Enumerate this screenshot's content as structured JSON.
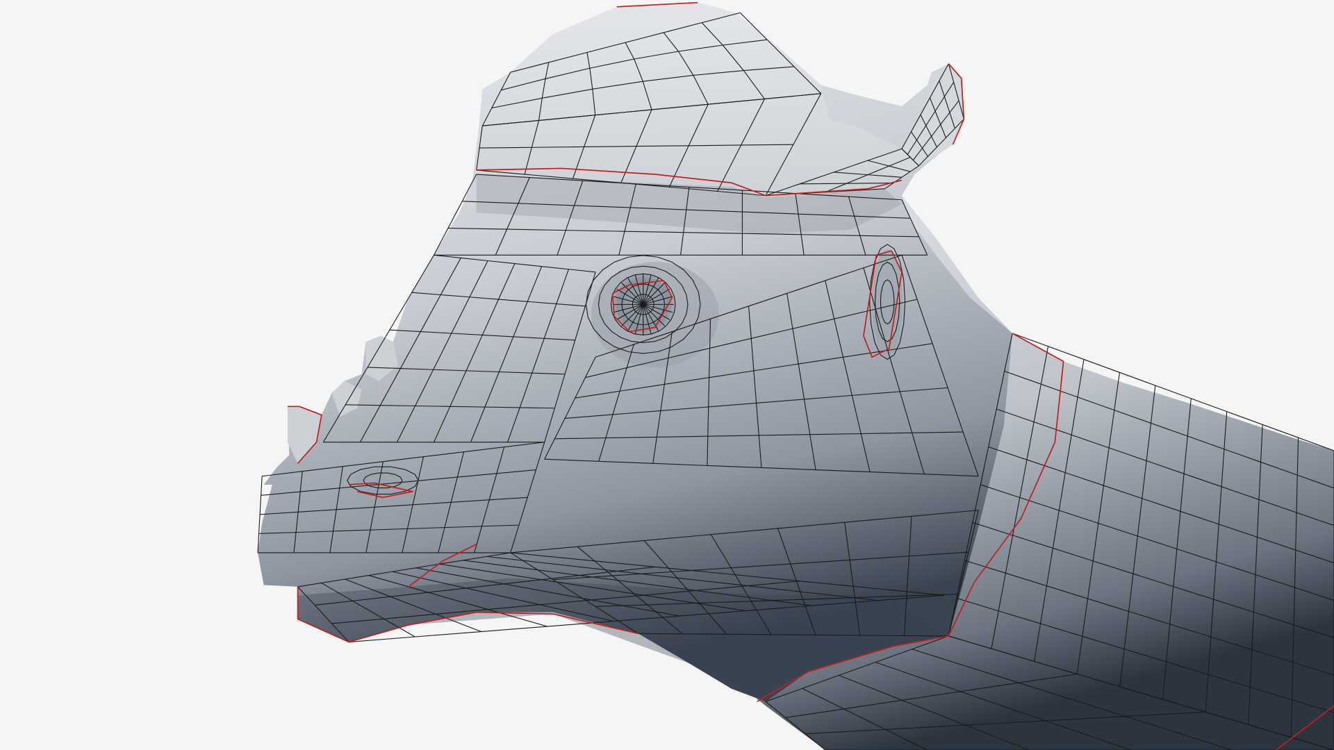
{
  "viewport": {
    "background_color": "#f5f5f5",
    "subject": "dinosaur-head-mesh",
    "shading": "grey-clay",
    "wireframe_color": "#1a1a1a",
    "seam_color": "#c0201c",
    "mesh_light": "#e9ebee",
    "mesh_mid": "#aab0b9",
    "mesh_dark": "#2f3844"
  }
}
